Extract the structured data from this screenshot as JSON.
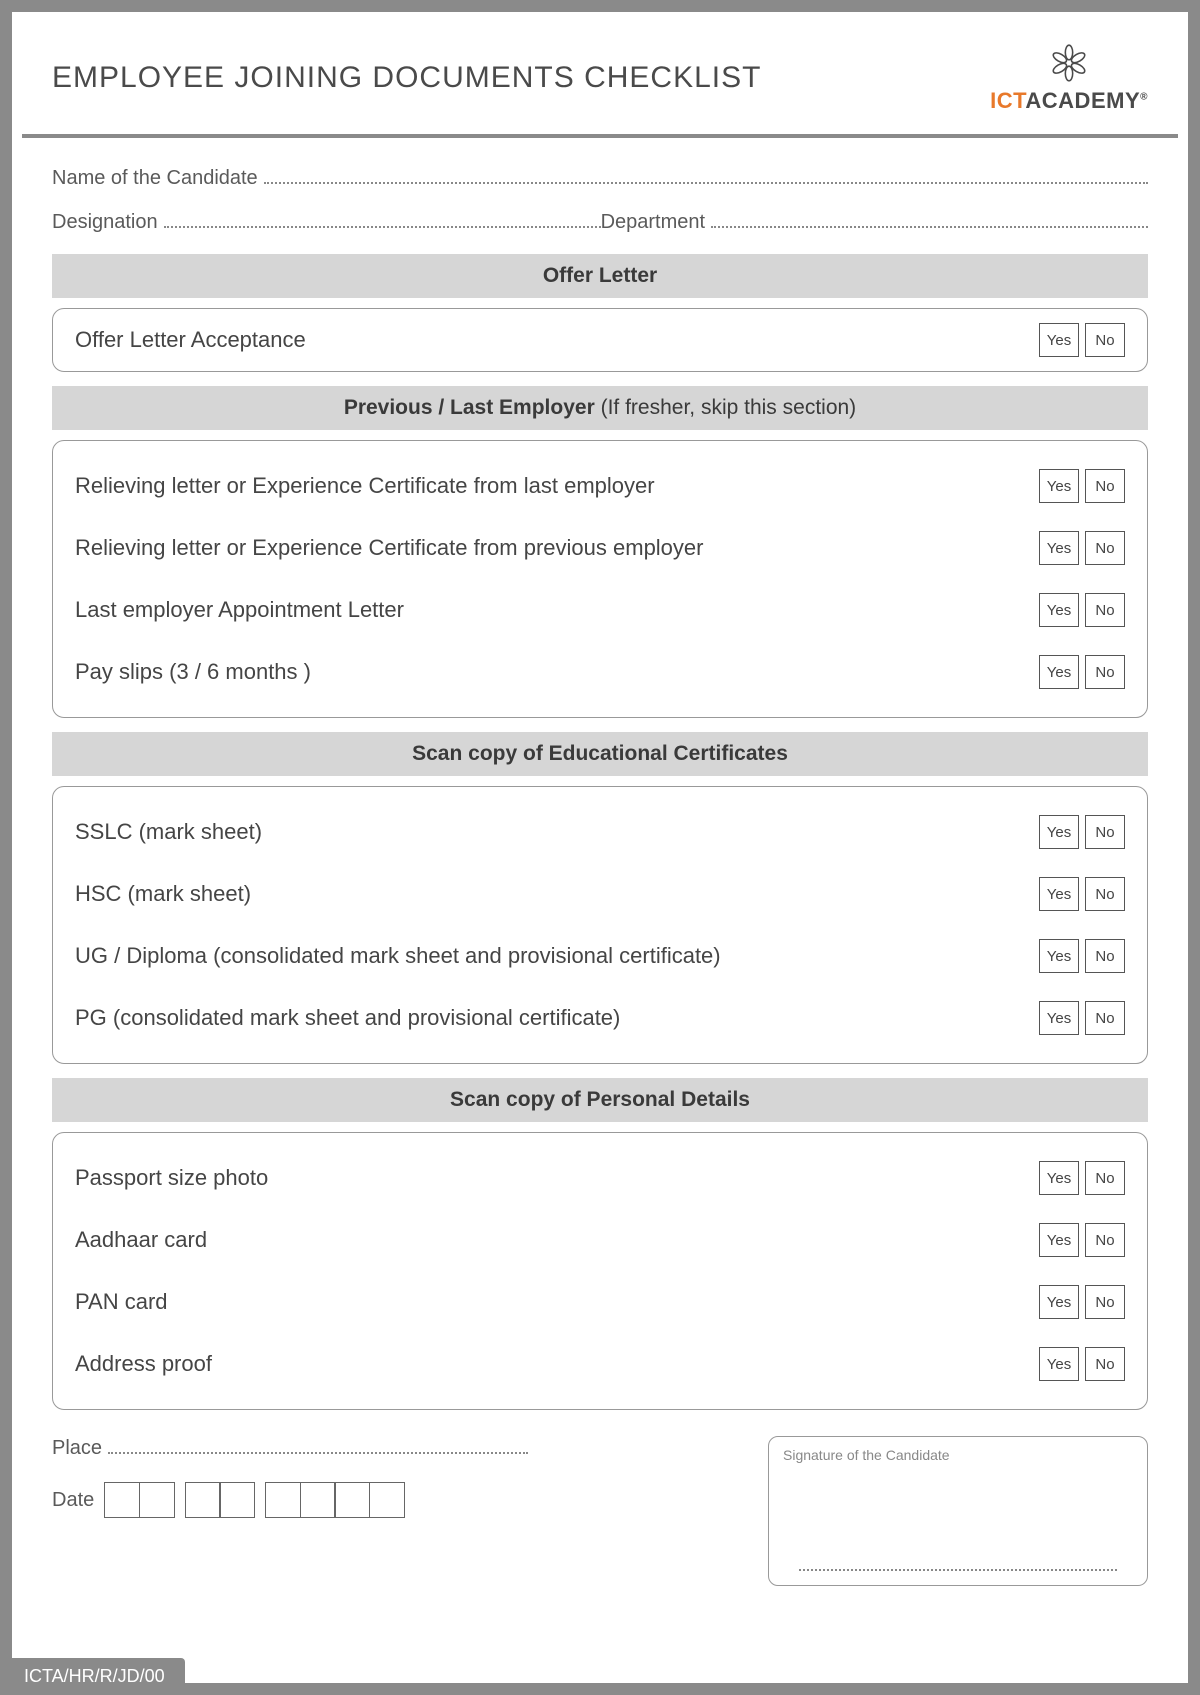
{
  "header": {
    "title": "EMPLOYEE JOINING DOCUMENTS CHECKLIST",
    "logo_ict": "ICT",
    "logo_academy": "ACADEMY"
  },
  "fields": {
    "name_label": "Name of the Candidate",
    "designation_label": "Designation",
    "department_label": "Department"
  },
  "sections": {
    "offer": {
      "title": "Offer Letter",
      "items": [
        "Offer Letter Acceptance"
      ]
    },
    "previous": {
      "title_bold": "Previous / Last Employer",
      "title_note": " (If fresher, skip this section)",
      "items": [
        "Relieving letter or Experience Certificate from last employer",
        "Relieving letter or Experience Certificate from previous employer",
        "Last employer Appointment Letter",
        "Pay slips (3 / 6 months )"
      ]
    },
    "education": {
      "title": "Scan copy of Educational Certificates",
      "items": [
        "SSLC (mark sheet)",
        "HSC (mark sheet)",
        "UG / Diploma (consolidated mark sheet and provisional certificate)",
        "PG (consolidated mark sheet and provisional certificate)"
      ]
    },
    "personal": {
      "title": "Scan copy of Personal Details",
      "items": [
        "Passport size photo",
        "Aadhaar card",
        "PAN card",
        "Address proof"
      ]
    }
  },
  "options": {
    "yes": "Yes",
    "no": "No"
  },
  "footer": {
    "place_label": "Place",
    "date_label": "Date",
    "signature_label": "Signature of the Candidate",
    "doc_code": "ICTA/HR/R/JD/00"
  }
}
